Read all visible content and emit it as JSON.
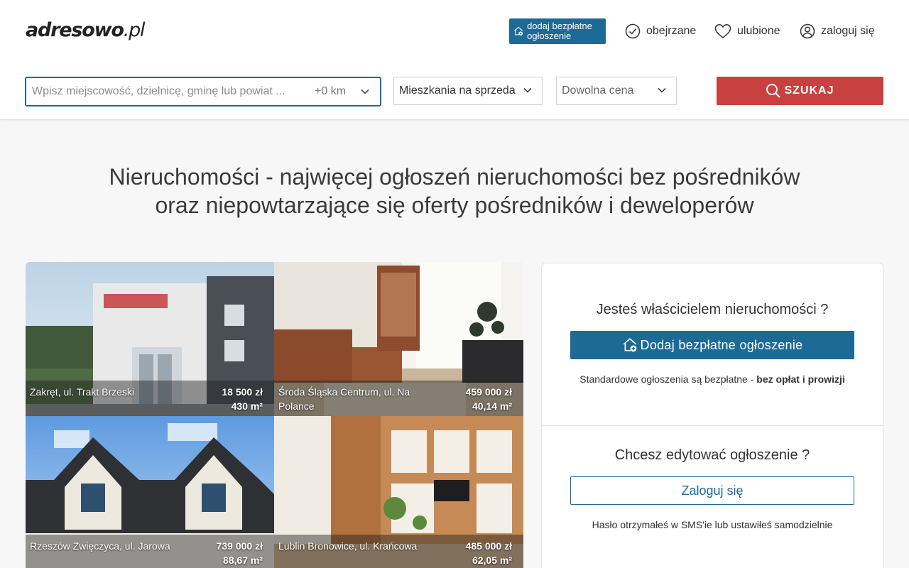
{
  "header": {
    "logo_main": "adresowo",
    "logo_tld": ".pl",
    "add_listing_label": "dodaj bezpłatne ogłoszenie",
    "nav": {
      "viewed": "obejrzane",
      "favorites": "ulubione",
      "login": "zaloguj się"
    }
  },
  "search": {
    "placeholder": "Wpisz miejscowość, dzielnicę, gminę lub powiat ...",
    "radius": "+0 km",
    "type_selected": "Mieszkania na sprzeda",
    "price_selected": "Dowolna cena",
    "submit_label": "SZUKAJ"
  },
  "headline": {
    "line1": "Nieruchomości - najwięcej ogłoszeń nieruchomości bez pośredników",
    "line2": "oraz niepowtarzające się oferty pośredników i deweloperów"
  },
  "listings": [
    {
      "location": "Zakręt, ul. Trakt Brzeski",
      "price": "18 500 zł",
      "area": "430 m²"
    },
    {
      "location": "Środa Śląska Centrum, ul. Na Polance",
      "price": "459 000 zł",
      "area": "40,14 m²"
    },
    {
      "location": "Rzeszów Zwięczyca, ul. Jarowa",
      "price": "739 000 zł",
      "area": "88,67 m²"
    },
    {
      "location": "Lublin Bronowice, ul. Krańcowa",
      "price": "485 000 zł",
      "area": "62,05 m²"
    }
  ],
  "owner_panel": {
    "owner_question": "Jesteś właścicielem nieruchomości ?",
    "add_button": "Dodaj bezpłatne ogłoszenie",
    "free_note": "Standardowe ogłoszenia są bezpłatne - ",
    "free_note_bold": "bez opłat i prowizji",
    "edit_question": "Chcesz edytować ogłoszenie ?",
    "login_button": "Zaloguj się",
    "password_note": "Hasło otrzymałeś w SMS'ie lub ustawiłeś samodzielnie"
  },
  "colors": {
    "brand_blue": "#1d6a96",
    "search_red": "#c8403f"
  }
}
